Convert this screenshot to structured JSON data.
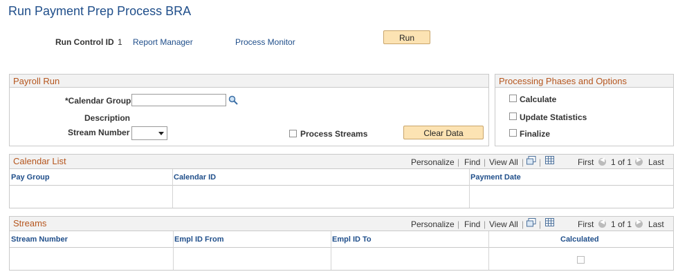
{
  "page": {
    "title": "Run Payment Prep Process BRA"
  },
  "run_control": {
    "label": "Run Control ID",
    "value": "1",
    "report_manager": "Report Manager",
    "process_monitor": "Process Monitor",
    "run_button": "Run"
  },
  "payroll_run": {
    "title": "Payroll Run",
    "calendar_group_label": "*Calendar Group",
    "calendar_group_value": "",
    "description_label": "Description",
    "stream_number_label": "Stream Number",
    "stream_number_value": "",
    "process_streams_label": "Process Streams",
    "clear_data_button": "Clear Data"
  },
  "phases": {
    "title": "Processing Phases and Options",
    "options": [
      {
        "label": "Calculate",
        "checked": false
      },
      {
        "label": "Update Statistics",
        "checked": false
      },
      {
        "label": "Finalize",
        "checked": false
      }
    ]
  },
  "grid_nav": {
    "personalize": "Personalize",
    "find": "Find",
    "view_all": "View All",
    "first": "First",
    "range": "1 of 1",
    "last": "Last"
  },
  "calendar_list": {
    "title": "Calendar List",
    "columns": [
      "Pay Group",
      "Calendar ID",
      "Payment Date"
    ]
  },
  "streams": {
    "title": "Streams",
    "columns": [
      "Stream Number",
      "Empl ID From",
      "Empl ID To",
      "Calculated"
    ]
  },
  "icons": {
    "lookup": "magnifier-icon",
    "dropdown": "chevron-down-icon",
    "zoom": "zoom-grid-icon",
    "download": "download-grid-icon",
    "prev": "prev-arrow-icon",
    "next": "next-arrow-icon"
  },
  "colors": {
    "title": "#1f4e8a",
    "section_title": "#b5551d",
    "button_bg": "#fce3b3"
  }
}
